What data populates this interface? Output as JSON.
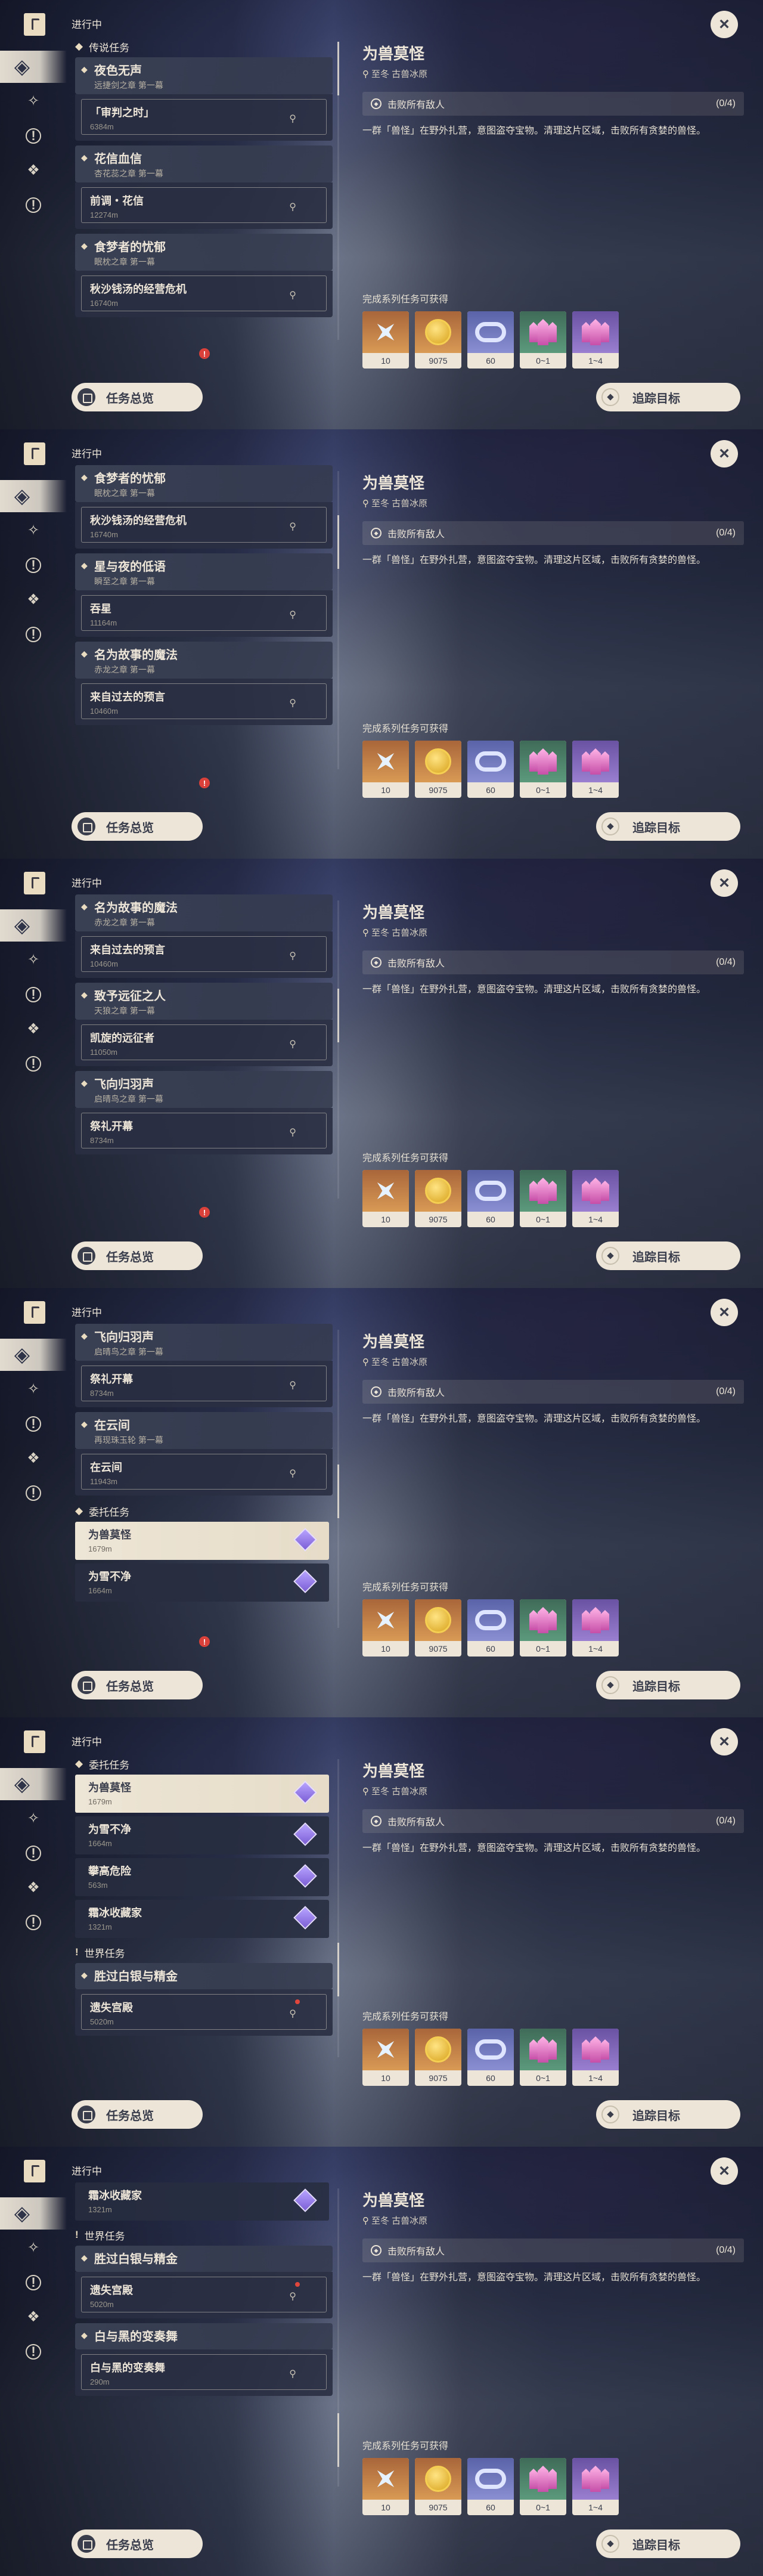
{
  "ui": {
    "in_progress": "进行中",
    "overview_label": "任务总览",
    "track_label": "追踪目标",
    "close_symbol": "×",
    "rewards_label": "完成系列任务可获得"
  },
  "detail": {
    "title": "为兽莫怪",
    "location": "至冬 古兽冰原",
    "objective": "击败所有敌人",
    "objective_count": "(0/4)",
    "description": "一群「兽怪」在野外扎营，意图盗夺宝物。清理这片区域，击败所有贪婪的兽怪。"
  },
  "rewards": [
    {
      "icon": "adventure-exp-icon",
      "count": "10",
      "color": "orange"
    },
    {
      "icon": "mora-icon",
      "count": "9075",
      "color": "orange"
    },
    {
      "icon": "fate-ring-icon",
      "count": "60",
      "color": "blue"
    },
    {
      "icon": "green-crystal-icon",
      "count": "0~1",
      "color": "green"
    },
    {
      "icon": "purple-crystal-icon",
      "count": "1~4",
      "color": "purple"
    }
  ],
  "panels": [
    {
      "scroll_pos": 0.0,
      "show_alert": true,
      "entries": [
        {
          "type": "section",
          "label": "传说任务",
          "pre": "◆"
        },
        {
          "type": "group",
          "title": "夜色无声",
          "sub": "远捷剑之章 第一幕"
        },
        {
          "type": "sub",
          "name": "「审判之时」",
          "dist": "6384m"
        },
        {
          "type": "group",
          "title": "花信血信",
          "sub": "杏花蕊之章 第一幕"
        },
        {
          "type": "sub",
          "name": "前调・花信",
          "dist": "12274m"
        },
        {
          "type": "group",
          "title": "食梦者的忧郁",
          "sub": "眠枕之章 第一幕"
        },
        {
          "type": "sub",
          "name": "秋沙钱汤的经营危机",
          "dist": "16740m"
        }
      ]
    },
    {
      "scroll_pos": 0.18,
      "show_alert": true,
      "entries": [
        {
          "type": "group",
          "title": "食梦者的忧郁",
          "sub": "眠枕之章 第一幕"
        },
        {
          "type": "sub",
          "name": "秋沙钱汤的经营危机",
          "dist": "16740m"
        },
        {
          "type": "group",
          "title": "星与夜的低语",
          "sub": "瞬至之章 第一幕"
        },
        {
          "type": "sub",
          "name": "吞星",
          "dist": "11164m"
        },
        {
          "type": "group",
          "title": "名为故事的魔法",
          "sub": "赤龙之章 第一幕"
        },
        {
          "type": "sub",
          "name": "来自过去的预言",
          "dist": "10460m"
        }
      ]
    },
    {
      "scroll_pos": 0.36,
      "show_alert": true,
      "entries": [
        {
          "type": "group",
          "title": "名为故事的魔法",
          "sub": "赤龙之章 第一幕"
        },
        {
          "type": "sub",
          "name": "来自过去的预言",
          "dist": "10460m"
        },
        {
          "type": "group",
          "title": "致予远征之人",
          "sub": "天狼之章 第一幕"
        },
        {
          "type": "sub",
          "name": "凯旋的远征者",
          "dist": "11050m"
        },
        {
          "type": "group",
          "title": "飞向归羽声",
          "sub": "启晴鸟之章 第一幕"
        },
        {
          "type": "sub",
          "name": "祭礼开幕",
          "dist": "8734m"
        }
      ]
    },
    {
      "scroll_pos": 0.55,
      "show_alert": true,
      "entries": [
        {
          "type": "group",
          "title": "飞向归羽声",
          "sub": "启晴鸟之章 第一幕"
        },
        {
          "type": "sub",
          "name": "祭礼开幕",
          "dist": "8734m"
        },
        {
          "type": "group",
          "title": "在云间",
          "sub": "再现珠玉轮 第一幕"
        },
        {
          "type": "sub",
          "name": "在云间",
          "dist": "11943m"
        },
        {
          "type": "section",
          "label": "委托任务",
          "pre": "◆"
        },
        {
          "type": "commission",
          "name": "为兽莫怪",
          "dist": "1679m",
          "selected": true
        },
        {
          "type": "commission",
          "name": "为雪不净",
          "dist": "1664m",
          "selected": false
        }
      ]
    },
    {
      "scroll_pos": 0.75,
      "show_alert": false,
      "entries": [
        {
          "type": "section",
          "label": "委托任务",
          "pre": "◆"
        },
        {
          "type": "commission",
          "name": "为兽莫怪",
          "dist": "1679m",
          "selected": true
        },
        {
          "type": "commission",
          "name": "为雪不净",
          "dist": "1664m",
          "selected": false
        },
        {
          "type": "commission",
          "name": "攀高危险",
          "dist": "563m",
          "selected": false
        },
        {
          "type": "commission",
          "name": "霜冰收藏家",
          "dist": "1321m",
          "selected": false
        },
        {
          "type": "section",
          "label": "世界任务",
          "pre": "!"
        },
        {
          "type": "group",
          "title": "胜过白银与精金",
          "sub": ""
        },
        {
          "type": "sub",
          "name": "遗失宫殿",
          "dist": "5020m",
          "dot": true
        }
      ]
    },
    {
      "scroll_pos": 0.92,
      "show_alert": false,
      "entries": [
        {
          "type": "commission",
          "name": "霜冰收藏家",
          "dist": "1321m",
          "selected": false
        },
        {
          "type": "section",
          "label": "世界任务",
          "pre": "!"
        },
        {
          "type": "group",
          "title": "胜过白银与精金",
          "sub": ""
        },
        {
          "type": "sub",
          "name": "遗失宫殿",
          "dist": "5020m",
          "dot": true
        },
        {
          "type": "group",
          "title": "白与黑的变奏舞",
          "sub": ""
        },
        {
          "type": "sub",
          "name": "白与黑的变奏舞",
          "dist": "290m"
        }
      ]
    }
  ]
}
